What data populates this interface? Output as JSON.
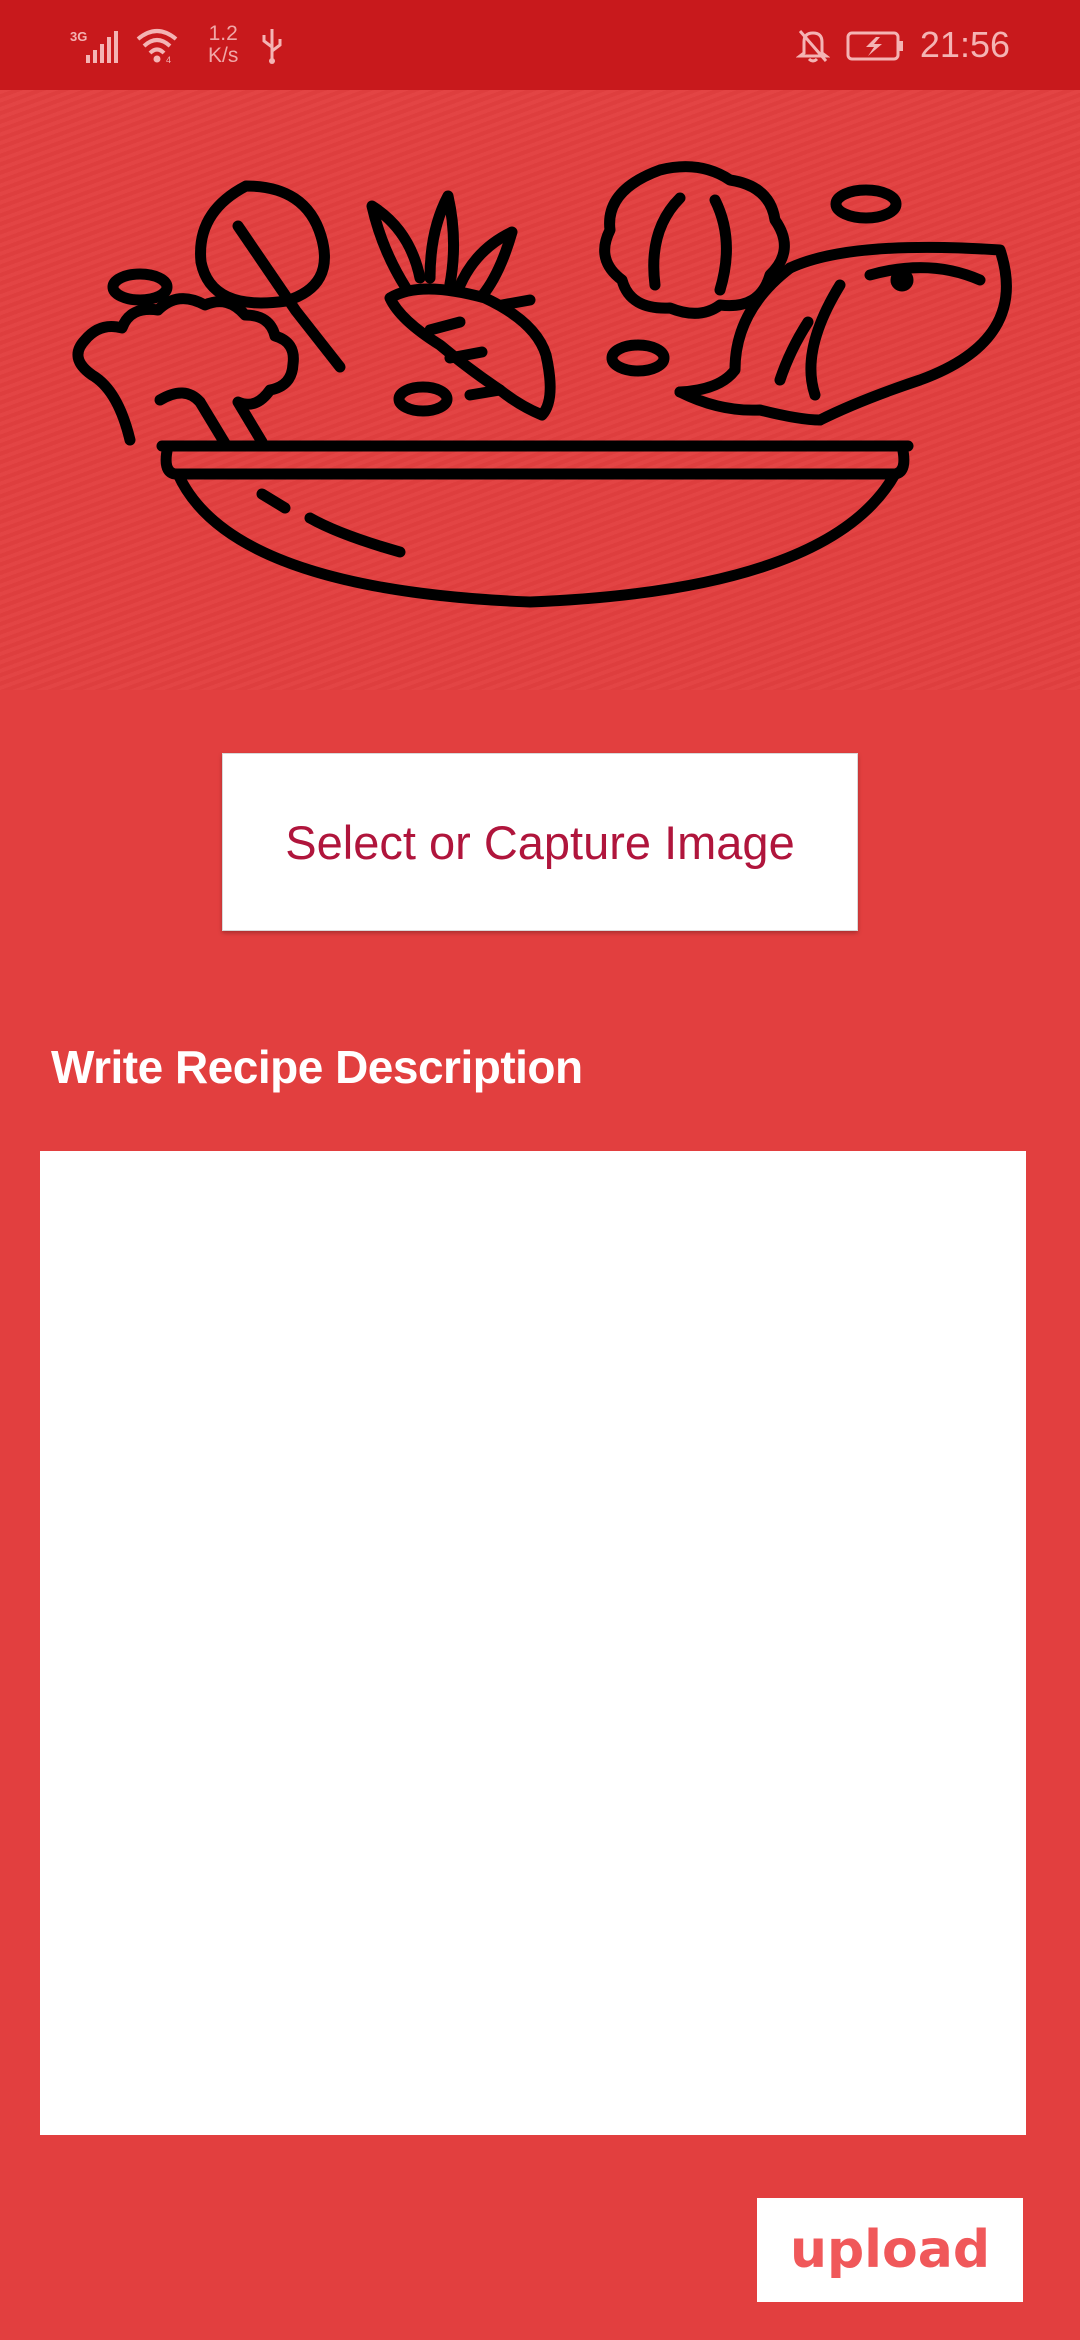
{
  "status_bar": {
    "network_type": "3G",
    "speed_value": "1.2",
    "speed_unit": "K/s",
    "time": "21:56",
    "icons": [
      "signal-icon",
      "wifi-icon",
      "usb-icon",
      "mute-bell-icon",
      "battery-charging-icon"
    ]
  },
  "hero": {
    "image": "salad-bowl-illustration"
  },
  "actions": {
    "select_image_label": "Select or Capture Image",
    "upload_label": "upload"
  },
  "description": {
    "label": "Write Recipe Description",
    "value": "",
    "placeholder": ""
  },
  "colors": {
    "background": "#E23F3F",
    "status_bar": "#C8191C",
    "select_text": "#B0153C",
    "upload_text": "#F0585A"
  }
}
